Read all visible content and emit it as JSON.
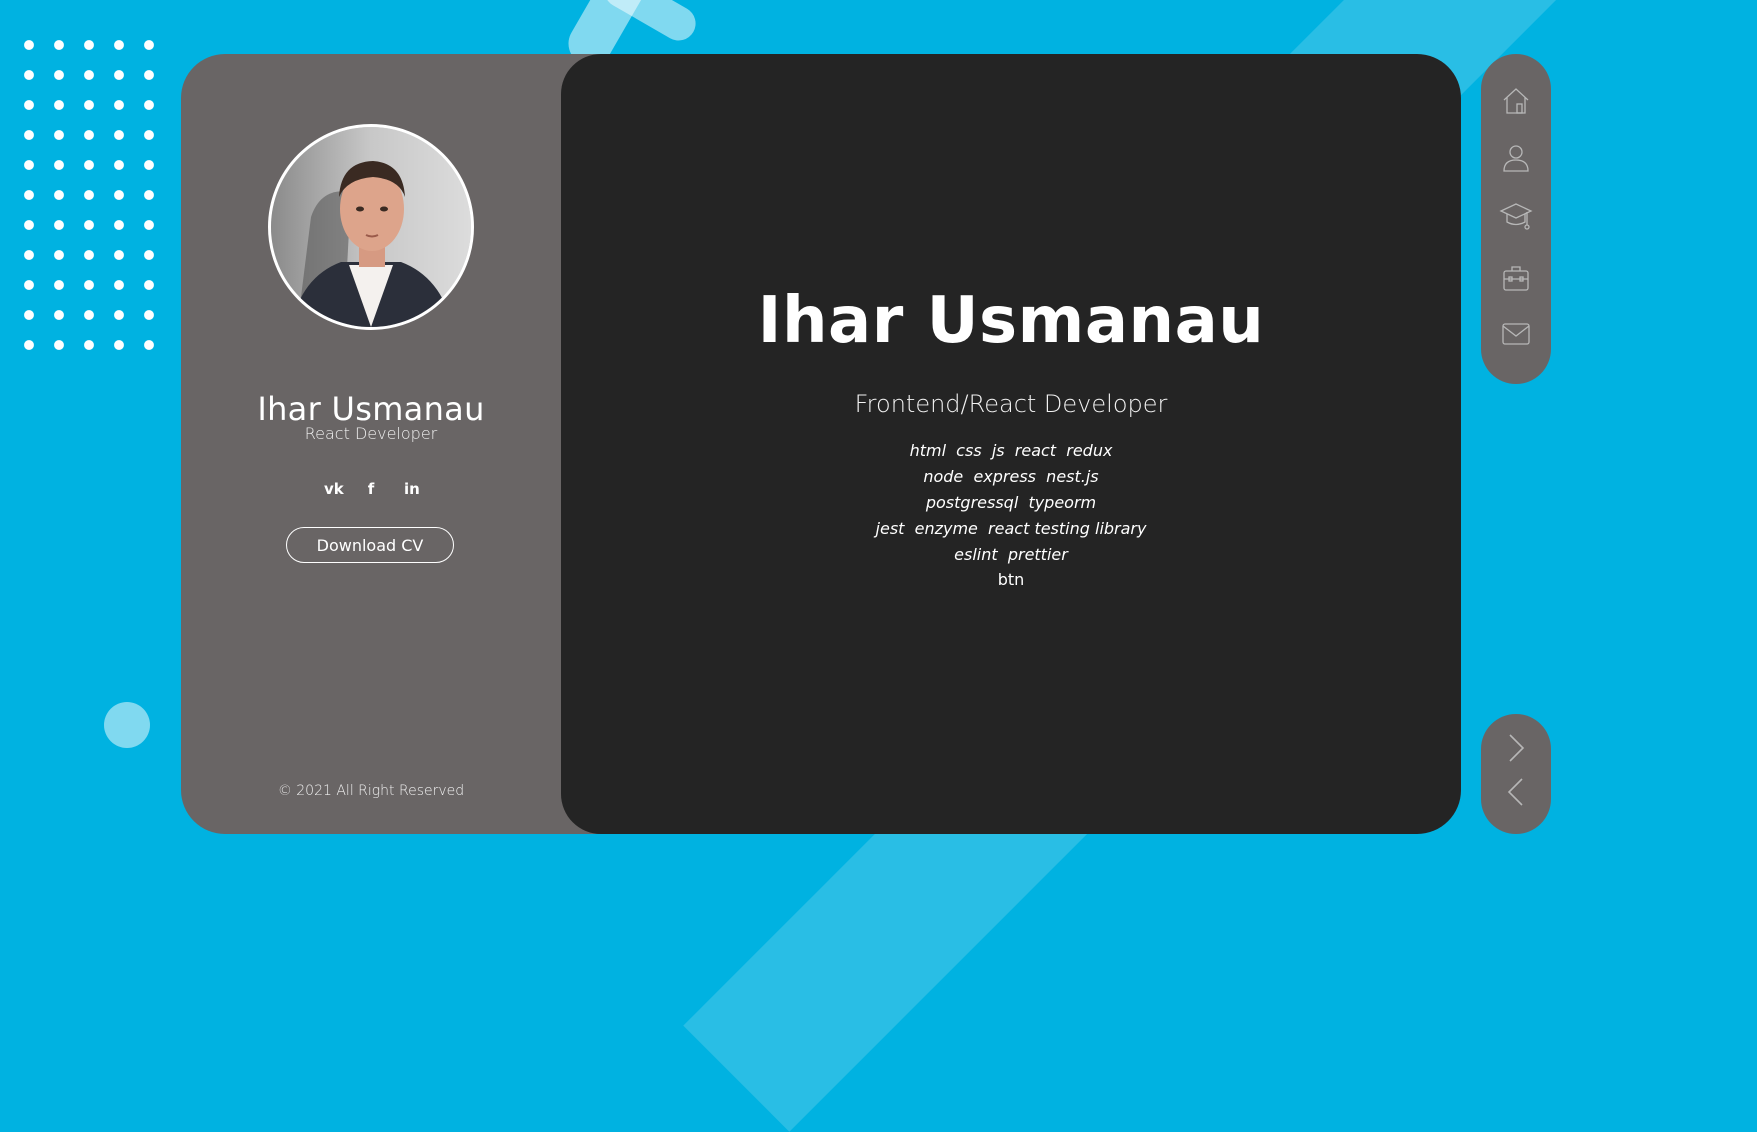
{
  "profile": {
    "name": "Ihar Usmanau",
    "role": "React Developer",
    "download_label": "Download CV",
    "copyright": "© 2021 All Right Reserved",
    "socials": [
      {
        "icon": "vk-icon",
        "glyph": "vk"
      },
      {
        "icon": "facebook-icon",
        "glyph": "f"
      },
      {
        "icon": "linkedin-icon",
        "glyph": "in"
      }
    ]
  },
  "hero": {
    "name": "Ihar Usmanau",
    "role": "Frontend/React Developer",
    "skills": [
      "html  css  js  react  redux",
      "node  express  nest.js",
      "postgressql  typeorm",
      "jest  enzyme  react testing library",
      "eslint  prettier"
    ],
    "btn": "btn"
  },
  "nav": {
    "items": [
      {
        "icon": "home-icon"
      },
      {
        "icon": "user-icon"
      },
      {
        "icon": "graduation-cap-icon"
      },
      {
        "icon": "briefcase-icon"
      },
      {
        "icon": "mail-icon"
      }
    ],
    "pager": [
      {
        "icon": "chevron-right-icon"
      },
      {
        "icon": "chevron-left-icon"
      }
    ]
  },
  "colors": {
    "background": "#00b2e1",
    "side_panel": "#696565",
    "main_panel": "#242424",
    "text": "#ffffff"
  }
}
